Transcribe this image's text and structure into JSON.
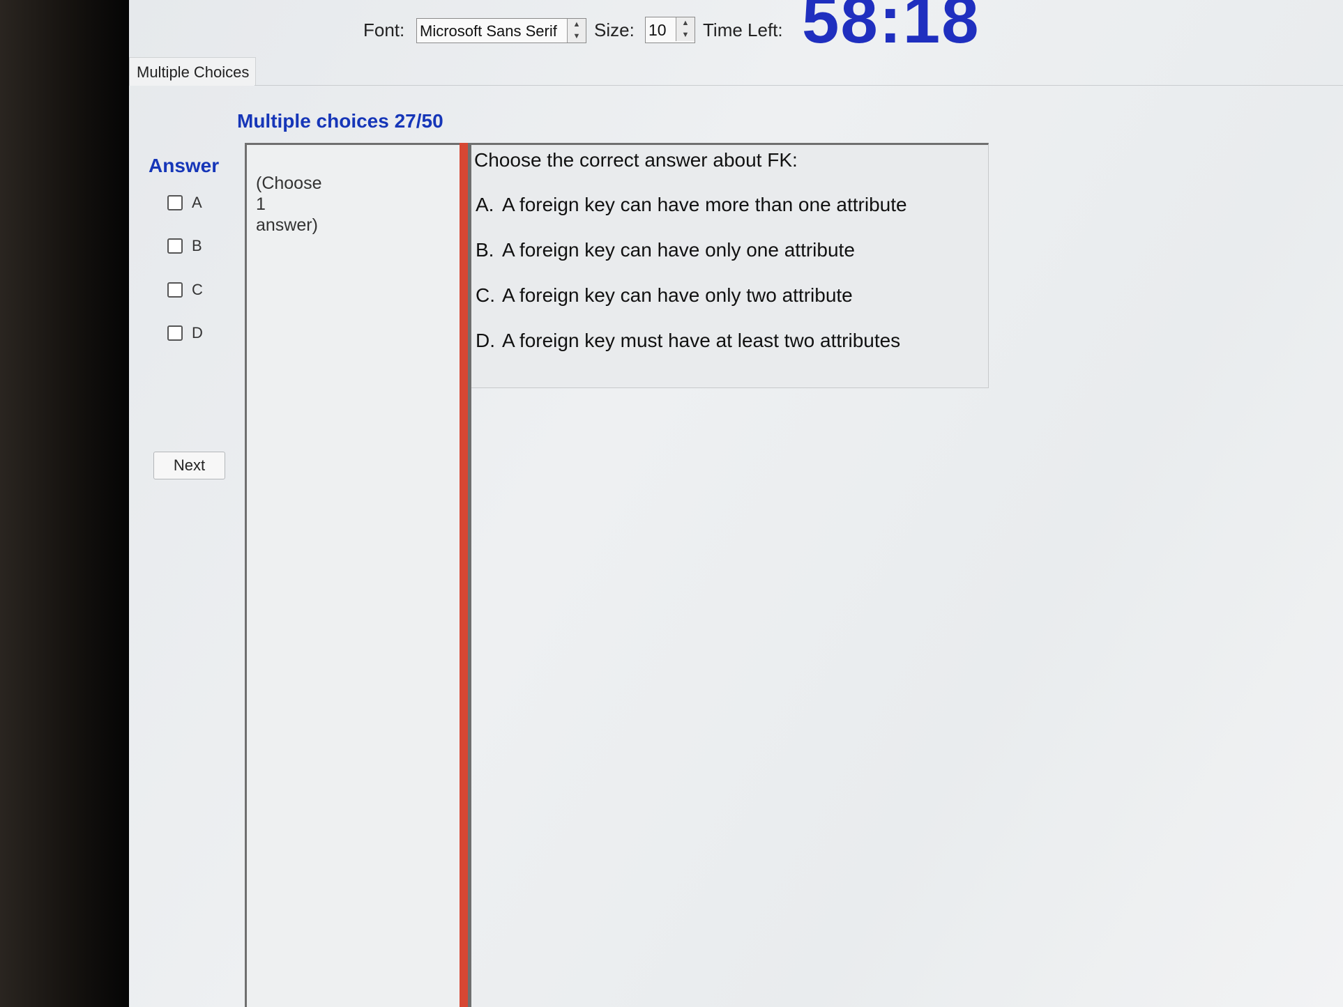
{
  "toolbar": {
    "font_label": "Font:",
    "font_value": "Microsoft Sans Serif",
    "size_label": "Size:",
    "size_value": "10",
    "time_label": "Time Left:",
    "time_value": "58:18"
  },
  "tab": {
    "label": "Multiple Choices"
  },
  "page_title": "Multiple choices 27/50",
  "answer": {
    "title": "Answer",
    "options": [
      "A",
      "B",
      "C",
      "D"
    ],
    "next_label": "Next"
  },
  "hint": {
    "lines": [
      "(Choose",
      "1",
      "answer)"
    ]
  },
  "question": {
    "text": "Choose the correct answer about FK:",
    "choices": [
      {
        "letter": "A.",
        "text": "A foreign key can have more than one attribute"
      },
      {
        "letter": "B.",
        "text": "A foreign key can have only one attribute"
      },
      {
        "letter": "C.",
        "text": "A foreign key can have only two attribute"
      },
      {
        "letter": "D.",
        "text": "A foreign key must have at least two attributes"
      }
    ]
  },
  "colors": {
    "accent_blue": "#1636b8",
    "timer_blue": "#1f2fbf",
    "divider_red": "#d74733"
  }
}
